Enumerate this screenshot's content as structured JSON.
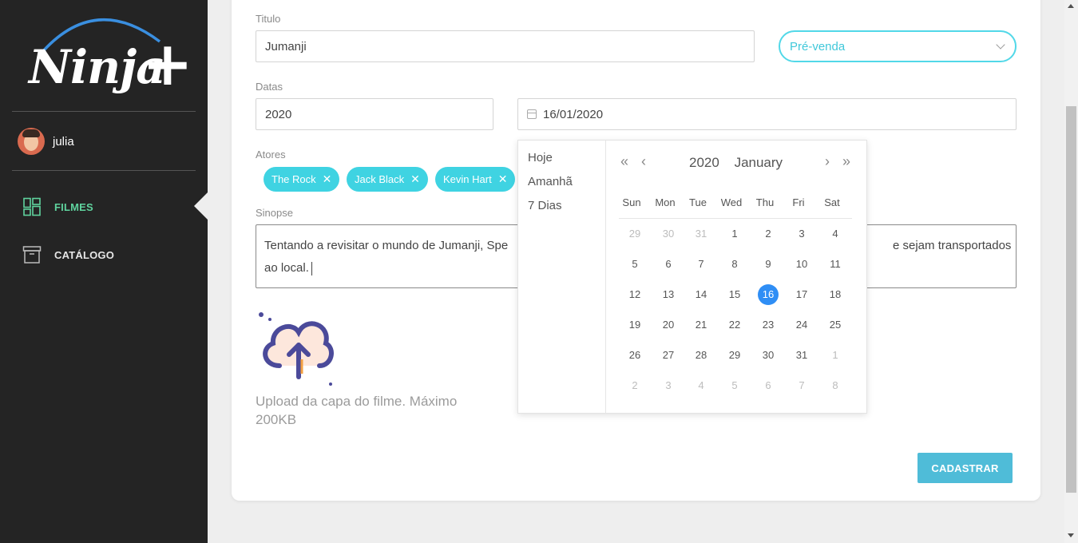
{
  "app": {
    "logo": "Ninja+"
  },
  "user": {
    "name": "julia"
  },
  "sidebar": {
    "items": [
      {
        "label": "FILMES",
        "icon": "dashboard-icon",
        "active": true
      },
      {
        "label": "CATÁLOGO",
        "icon": "archive-icon",
        "active": false
      }
    ]
  },
  "form": {
    "title_label": "Titulo",
    "title_value": "Jumanji",
    "status_value": "Pré-venda",
    "dates_label": "Datas",
    "year_value": "2020",
    "date_value": "16/01/2020",
    "actors_label": "Atores",
    "actors": [
      "The Rock",
      "Jack Black",
      "Kevin Hart"
    ],
    "synopsis_label": "Sinopse",
    "synopsis_value_line1": "Tentando a revisitar o mundo de Jumanji, Spe",
    "synopsis_value_tail": "e sejam transportados",
    "synopsis_value_line2": "ao local.",
    "upload_text": "Upload da capa do filme. Máximo 200KB",
    "submit_label": "CADASTRAR"
  },
  "datepicker": {
    "presets": [
      "Hoje",
      "Amanhã",
      "7 Dias"
    ],
    "year": "2020",
    "month": "January",
    "weekdays": [
      "Sun",
      "Mon",
      "Tue",
      "Wed",
      "Thu",
      "Fri",
      "Sat"
    ],
    "selected_day": "16",
    "weeks": [
      [
        "29",
        "30",
        "31",
        "1",
        "2",
        "3",
        "4"
      ],
      [
        "5",
        "6",
        "7",
        "8",
        "9",
        "10",
        "11"
      ],
      [
        "12",
        "13",
        "14",
        "15",
        "16",
        "17",
        "18"
      ],
      [
        "19",
        "20",
        "21",
        "22",
        "23",
        "24",
        "25"
      ],
      [
        "26",
        "27",
        "28",
        "29",
        "30",
        "31",
        "1"
      ],
      [
        "2",
        "3",
        "4",
        "5",
        "6",
        "7",
        "8"
      ]
    ]
  },
  "colors": {
    "accent": "#3fd3e2",
    "selected": "#2f8ef5",
    "active_nav": "#5fd39e",
    "button": "#4fbcd8"
  }
}
